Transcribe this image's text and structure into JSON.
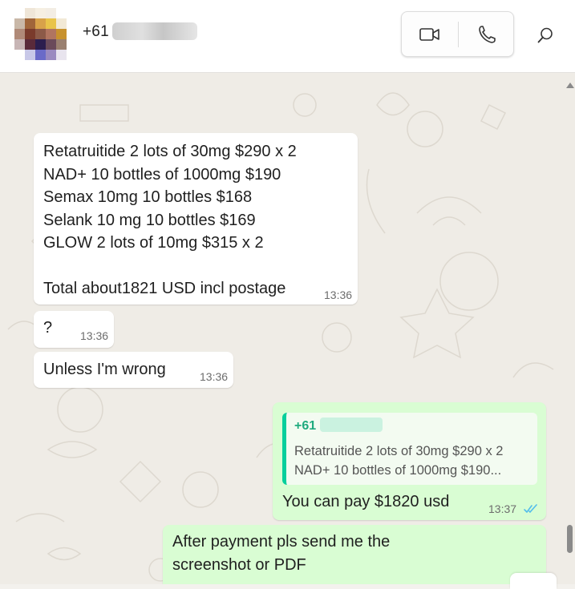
{
  "header": {
    "contact_name": "+61",
    "icons": {
      "video": "video-camera-icon",
      "voice": "phone-icon",
      "search": "search-icon"
    }
  },
  "messages": [
    {
      "direction": "incoming",
      "text": "Retatruitide 2 lots of 30mg $290 x 2\nNAD+ 10 bottles of 1000mg $190\nSemax 10mg 10 bottles $168\nSelank 10 mg 10 bottles $169\nGLOW 2 lots of 10mg $315 x 2\n\nTotal about1821 USD incl postage",
      "time": "13:36"
    },
    {
      "direction": "incoming",
      "text": "?",
      "time": "13:36"
    },
    {
      "direction": "incoming",
      "text": "Unless I'm wrong",
      "time": "13:36"
    },
    {
      "direction": "outgoing",
      "quote": {
        "author": "+61",
        "line1": "Retatruitide 2 lots of 30mg $290 x 2",
        "line2": "NAD+ 10 bottles of 1000mg $190..."
      },
      "text": "You can pay $1820 usd",
      "time": "13:37",
      "status": "read"
    },
    {
      "direction": "outgoing",
      "text": "After payment pls send me the\nscreenshot or PDF"
    }
  ],
  "colors": {
    "incoming_bubble": "#ffffff",
    "outgoing_bubble": "#d9fdd3",
    "chat_bg": "#efece6",
    "read_ticks": "#53bdeb",
    "quote_accent": "#06cf9c"
  }
}
